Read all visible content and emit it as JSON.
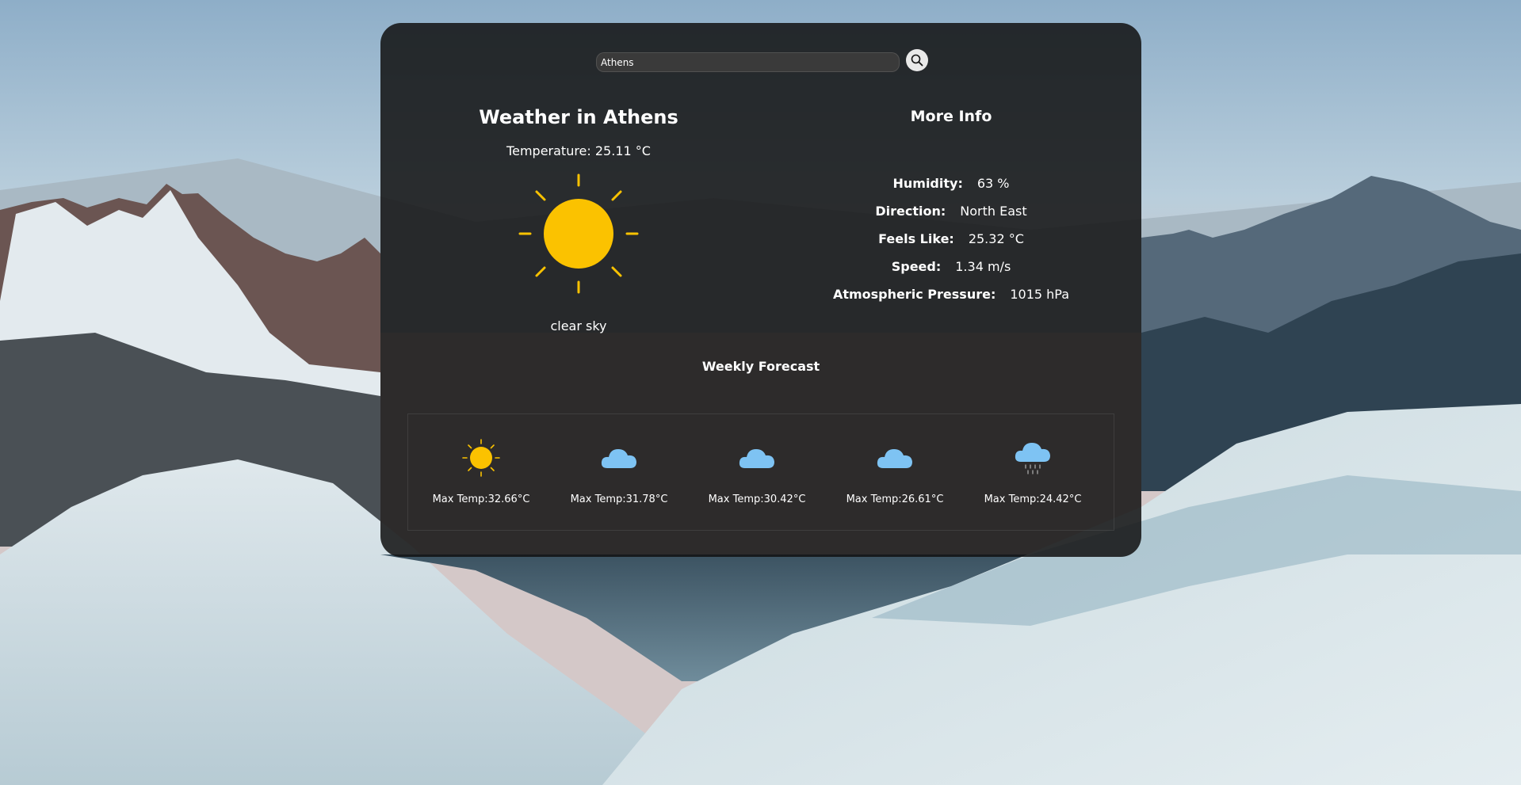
{
  "search": {
    "value": "Athens"
  },
  "current": {
    "title": "Weather in Athens",
    "temperature_text": "Temperature: 25.11 °C",
    "icon": "sun-icon",
    "description": "clear sky"
  },
  "more_info": {
    "title": "More Info",
    "items": [
      {
        "label": "Humidity:",
        "value": "63 %"
      },
      {
        "label": "Direction:",
        "value": "North East"
      },
      {
        "label": "Feels Like:",
        "value": "25.32 °C"
      },
      {
        "label": "Speed:",
        "value": "1.34 m/s"
      },
      {
        "label": "Atmospheric Pressure:",
        "value": "1015 hPa"
      }
    ]
  },
  "weekly": {
    "title": "Weekly Forecast",
    "days": [
      {
        "icon": "sun-icon",
        "max_temp": "Max Temp:32.66°C"
      },
      {
        "icon": "cloud-icon",
        "max_temp": "Max Temp:31.78°C"
      },
      {
        "icon": "cloud-icon",
        "max_temp": "Max Temp:30.42°C"
      },
      {
        "icon": "cloud-icon",
        "max_temp": "Max Temp:26.61°C"
      },
      {
        "icon": "rain-cloud-icon",
        "max_temp": "Max Temp:24.42°C"
      }
    ]
  },
  "colors": {
    "sun": "#fbc200",
    "cloud": "#7ec3f3",
    "rain": "#a7a7a7",
    "card": "#121212"
  }
}
